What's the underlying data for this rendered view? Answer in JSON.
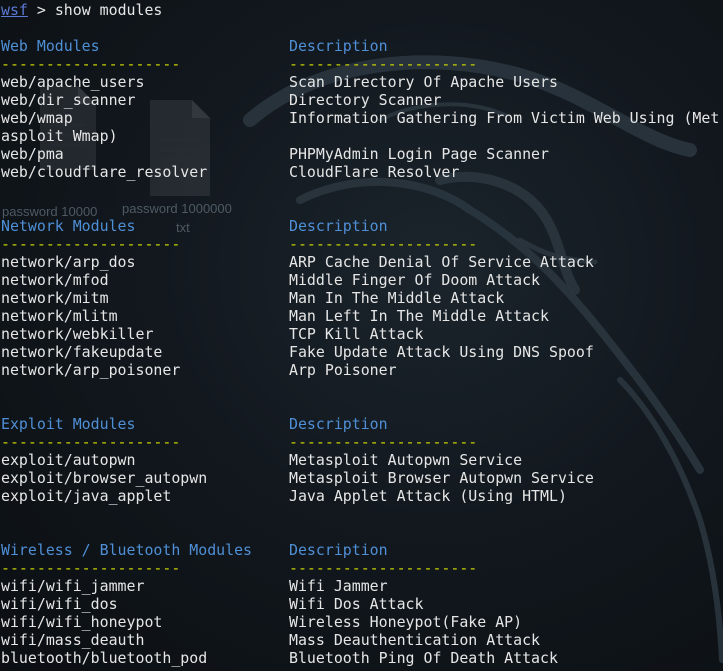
{
  "prompt": {
    "user": "wsf",
    "separator": " > ",
    "command": "show modules"
  },
  "sections": [
    {
      "header": "Web Modules",
      "desc_header": "Description",
      "dashes": "--------------------",
      "desc_dashes": "---------------------",
      "rows": [
        {
          "name": "web/apache_users",
          "desc": "Scan Directory Of Apache Users"
        },
        {
          "name": "web/dir_scanner",
          "desc": "Directory Scanner"
        },
        {
          "name": "web/wmap",
          "desc": "Information Gathering From Victim Web Using (Met"
        },
        {
          "name": "asploit Wmap)",
          "desc": ""
        },
        {
          "name": "web/pma",
          "desc": "PHPMyAdmin Login Page Scanner"
        },
        {
          "name": "web/cloudflare_resolver",
          "desc": "CloudFlare Resolver"
        }
      ]
    },
    {
      "header": "Network Modules",
      "desc_header": "Description",
      "dashes": "--------------------",
      "desc_dashes": "---------------------",
      "rows": [
        {
          "name": "network/arp_dos",
          "desc": "ARP Cache Denial Of Service Attack"
        },
        {
          "name": "network/mfod",
          "desc": "Middle Finger Of Doom Attack"
        },
        {
          "name": "network/mitm",
          "desc": "Man In The Middle Attack"
        },
        {
          "name": "network/mlitm",
          "desc": "Man Left In The Middle Attack"
        },
        {
          "name": "network/webkiller",
          "desc": "TCP Kill Attack"
        },
        {
          "name": "network/fakeupdate",
          "desc": "Fake Update Attack Using DNS Spoof"
        },
        {
          "name": "network/arp_poisoner",
          "desc": "Arp Poisoner"
        }
      ]
    },
    {
      "header": "Exploit Modules",
      "desc_header": "Description",
      "dashes": "--------------------",
      "desc_dashes": "---------------------",
      "rows": [
        {
          "name": "exploit/autopwn",
          "desc": "Metasploit Autopwn Service"
        },
        {
          "name": "exploit/browser_autopwn",
          "desc": "Metasploit Browser Autopwn Service"
        },
        {
          "name": "exploit/java_applet",
          "desc": "Java Applet Attack (Using HTML)"
        }
      ]
    },
    {
      "header": "Wireless / Bluetooth Modules",
      "desc_header": "Description",
      "dashes": "--------------------",
      "desc_dashes": "---------------------",
      "rows": [
        {
          "name": "wifi/wifi_jammer",
          "desc": "Wifi Jammer"
        },
        {
          "name": "wifi/wifi_dos",
          "desc": "Wifi Dos Attack"
        },
        {
          "name": "wifi/wifi_honeypot",
          "desc": "Wireless Honeypot(Fake AP)"
        },
        {
          "name": "wifi/mass_deauth",
          "desc": "Mass Deauthentication Attack"
        },
        {
          "name": "bluetooth/bluetooth_pod",
          "desc": "Bluetooth Ping Of Death Attack"
        }
      ]
    }
  ],
  "wallpaper": {
    "file_label_1": "password 10000",
    "file_label_2": "password 1000000",
    "file_label_ext": "txt"
  },
  "colors": {
    "prompt": "#5c7ad6",
    "header": "#4f8fd6",
    "dashes": "#c8d400",
    "text": "#e6e6e6"
  }
}
